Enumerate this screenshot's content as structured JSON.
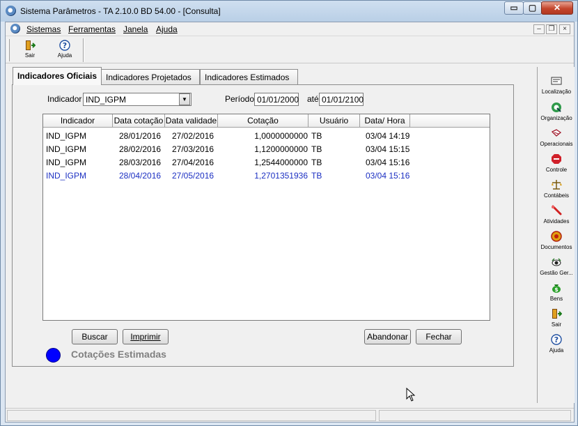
{
  "window": {
    "title": "Sistema Parâmetros -  TA 2.10.0 BD 54.00 - [Consulta]",
    "caption_buttons": {
      "minimize": "▭",
      "maximize": "▢",
      "close": "✕"
    }
  },
  "menubar": {
    "items": [
      {
        "label": "Sistemas"
      },
      {
        "label": "Ferramentas"
      },
      {
        "label": "Janela"
      },
      {
        "label": "Ajuda"
      }
    ],
    "mdi_buttons": {
      "minimize": "–",
      "restore": "❐",
      "close": "×"
    }
  },
  "toolbar": {
    "items": [
      {
        "label": "Sair",
        "icon": "exit-door-icon"
      },
      {
        "label": "Ajuda",
        "icon": "help-icon"
      }
    ]
  },
  "rightbar": {
    "items": [
      {
        "label": "Localização",
        "icon": "location-icon"
      },
      {
        "label": "Organização",
        "icon": "organization-icon"
      },
      {
        "label": "Operacionais",
        "icon": "operational-icon"
      },
      {
        "label": "Controle",
        "icon": "control-icon"
      },
      {
        "label": "Contábeis",
        "icon": "accounting-icon"
      },
      {
        "label": "Atividades",
        "icon": "activities-icon"
      },
      {
        "label": "Documentos",
        "icon": "documents-icon"
      },
      {
        "label": "Gestão Ger...",
        "icon": "management-icon"
      },
      {
        "label": "Bens",
        "icon": "assets-icon"
      },
      {
        "label": "Sair",
        "icon": "exit-door-icon"
      },
      {
        "label": "Ajuda",
        "icon": "help-icon"
      }
    ]
  },
  "tabs": [
    {
      "label": "Indicadores Oficiais",
      "active": true
    },
    {
      "label": "Indicadores Projetados",
      "active": false
    },
    {
      "label": "Indicadores Estimados",
      "active": false
    }
  ],
  "filters": {
    "indicador_label": "Indicador",
    "indicador_value": "IND_IGPM",
    "periodo_label": "Período",
    "periodo_from": "01/01/2000",
    "ate_label": "até",
    "periodo_to": "01/01/2100"
  },
  "table": {
    "columns": [
      "Indicador",
      "Data cotação",
      "Data validade",
      "Cotação",
      "Usuário",
      "Data/ Hora"
    ],
    "rows": [
      {
        "indicador": "IND_IGPM",
        "data_cotacao": "28/01/2016",
        "data_validade": "27/02/2016",
        "cotacao": "1,0000000000",
        "usuario": "TB",
        "data_hora": "03/04 14:19",
        "estimated": false
      },
      {
        "indicador": "IND_IGPM",
        "data_cotacao": "28/02/2016",
        "data_validade": "27/03/2016",
        "cotacao": "1,1200000000",
        "usuario": "TB",
        "data_hora": "03/04 15:15",
        "estimated": false
      },
      {
        "indicador": "IND_IGPM",
        "data_cotacao": "28/03/2016",
        "data_validade": "27/04/2016",
        "cotacao": "1,2544000000",
        "usuario": "TB",
        "data_hora": "03/04 15:16",
        "estimated": false
      },
      {
        "indicador": "IND_IGPM",
        "data_cotacao": "28/04/2016",
        "data_validade": "27/05/2016",
        "cotacao": "1,2701351936",
        "usuario": "TB",
        "data_hora": "03/04 15:16",
        "estimated": true
      }
    ]
  },
  "buttons": {
    "buscar": "Buscar",
    "imprimir": "Imprimir",
    "abandonar": "Abandonar",
    "fechar": "Fechar"
  },
  "legend": {
    "label": "Cotações Estimadas",
    "color": "#0000ff"
  },
  "colors": {
    "estimated_row_text": "#1b2fc2",
    "normal_row_text": "#000000"
  }
}
